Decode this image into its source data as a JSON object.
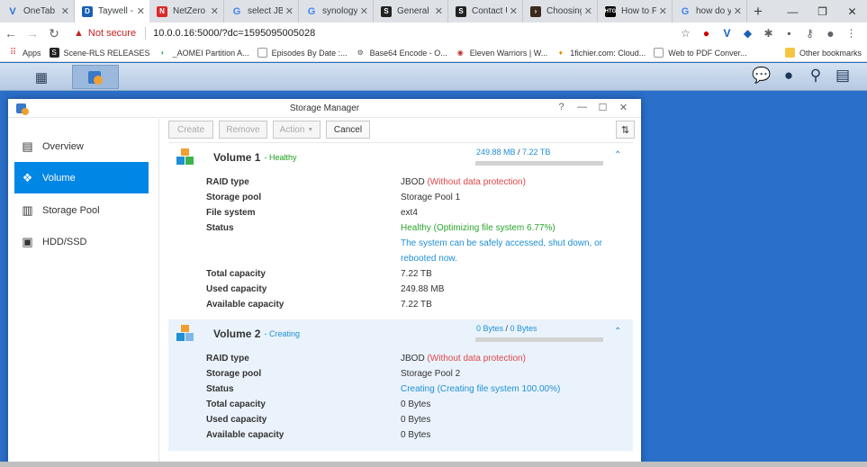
{
  "browser": {
    "tabs": [
      {
        "title": "OneTab",
        "icon": "onetab-icon",
        "color": "#2f6fd6"
      },
      {
        "title": "Taywell - ",
        "icon": "dsm-icon",
        "color": "#1a5fb4"
      },
      {
        "title": "NetZero - ",
        "icon": "netzero-icon",
        "color": "#d92b2b"
      },
      {
        "title": "select JBOD",
        "icon": "google-icon",
        "color": "#4285f4"
      },
      {
        "title": "synology ",
        "icon": "google-icon",
        "color": "#4285f4"
      },
      {
        "title": "General | ",
        "icon": "s-icon",
        "color": "#222222"
      },
      {
        "title": "Contact U",
        "icon": "s-icon",
        "color": "#222222"
      },
      {
        "title": "Choosing",
        "icon": "chevron-icon",
        "color": "#3a2a1a"
      },
      {
        "title": "How to F",
        "icon": "htg-icon",
        "color": "#000000"
      },
      {
        "title": "how do yo",
        "icon": "google-icon",
        "color": "#4285f4"
      }
    ],
    "new_tab_label": "+",
    "address": {
      "warning_label": "Not secure",
      "url": "10.0.0.16:5000/?dc=1595095005028"
    },
    "bookmarks": [
      {
        "label": "Apps",
        "icon": "apps-icon"
      },
      {
        "label": "Scene-RLS RELEASES",
        "icon": "s-icon"
      },
      {
        "label": "_AOMEI Partition A...",
        "icon": "aomei-icon"
      },
      {
        "label": "Episodes By Date :...",
        "icon": "doc-icon"
      },
      {
        "label": "Base64 Encode - O...",
        "icon": "gear-icon"
      },
      {
        "label": "Eleven Warriors | W...",
        "icon": "ew-icon"
      },
      {
        "label": "1fichier.com: Cloud...",
        "icon": "flame-icon"
      },
      {
        "label": "Web to PDF Conver...",
        "icon": "doc-icon"
      }
    ],
    "other_bookmarks": "Other bookmarks"
  },
  "window": {
    "title": "Storage Manager",
    "sidebar": [
      {
        "label": "Overview",
        "icon": "overview-icon",
        "selected": false
      },
      {
        "label": "Volume",
        "icon": "volume-icon",
        "selected": true
      },
      {
        "label": "Storage Pool",
        "icon": "storage-pool-icon",
        "selected": false
      },
      {
        "label": "HDD/SSD",
        "icon": "hdd-icon",
        "selected": false
      }
    ],
    "actions": {
      "create": "Create",
      "remove": "Remove",
      "action": "Action",
      "cancel": "Cancel"
    }
  },
  "volumes": [
    {
      "name": "Volume 1",
      "state": "- Healthy",
      "used": "249.88 MB",
      "total": "7.22 TB",
      "usage_fraction": 0.0,
      "details": [
        {
          "label": "RAID type",
          "value": "JBOD",
          "note": "(Without data protection)"
        },
        {
          "label": "Storage pool",
          "value": "Storage Pool 1"
        },
        {
          "label": "File system",
          "value": "ext4"
        },
        {
          "label": "Status",
          "value": "Healthy (Optimizing file system 6.77%)"
        }
      ],
      "status_message": [
        "The system can be safely accessed, shut down, or",
        "rebooted now."
      ],
      "capacity": [
        {
          "label": "Total capacity",
          "value": "7.22 TB"
        },
        {
          "label": "Used capacity",
          "value": "249.88 MB"
        },
        {
          "label": "Available capacity",
          "value": "7.22 TB"
        }
      ]
    },
    {
      "name": "Volume 2",
      "state": "- Creating",
      "used": "0 Bytes",
      "total": "0 Bytes",
      "usage_fraction": 0.0,
      "details": [
        {
          "label": "RAID type",
          "value": "JBOD",
          "note": "(Without data protection)"
        },
        {
          "label": "Storage pool",
          "value": "Storage Pool 2"
        },
        {
          "label": "Status",
          "value": "Creating (Creating file system 100.00%)"
        }
      ],
      "capacity": [
        {
          "label": "Total capacity",
          "value": "0 Bytes"
        },
        {
          "label": "Used capacity",
          "value": "0 Bytes"
        },
        {
          "label": "Available capacity",
          "value": "0 Bytes"
        }
      ]
    }
  ],
  "colors": {
    "accent": "#0086e5",
    "healthy": "#2aa52a",
    "warning": "#e0454a",
    "link": "#1f8fd6"
  }
}
